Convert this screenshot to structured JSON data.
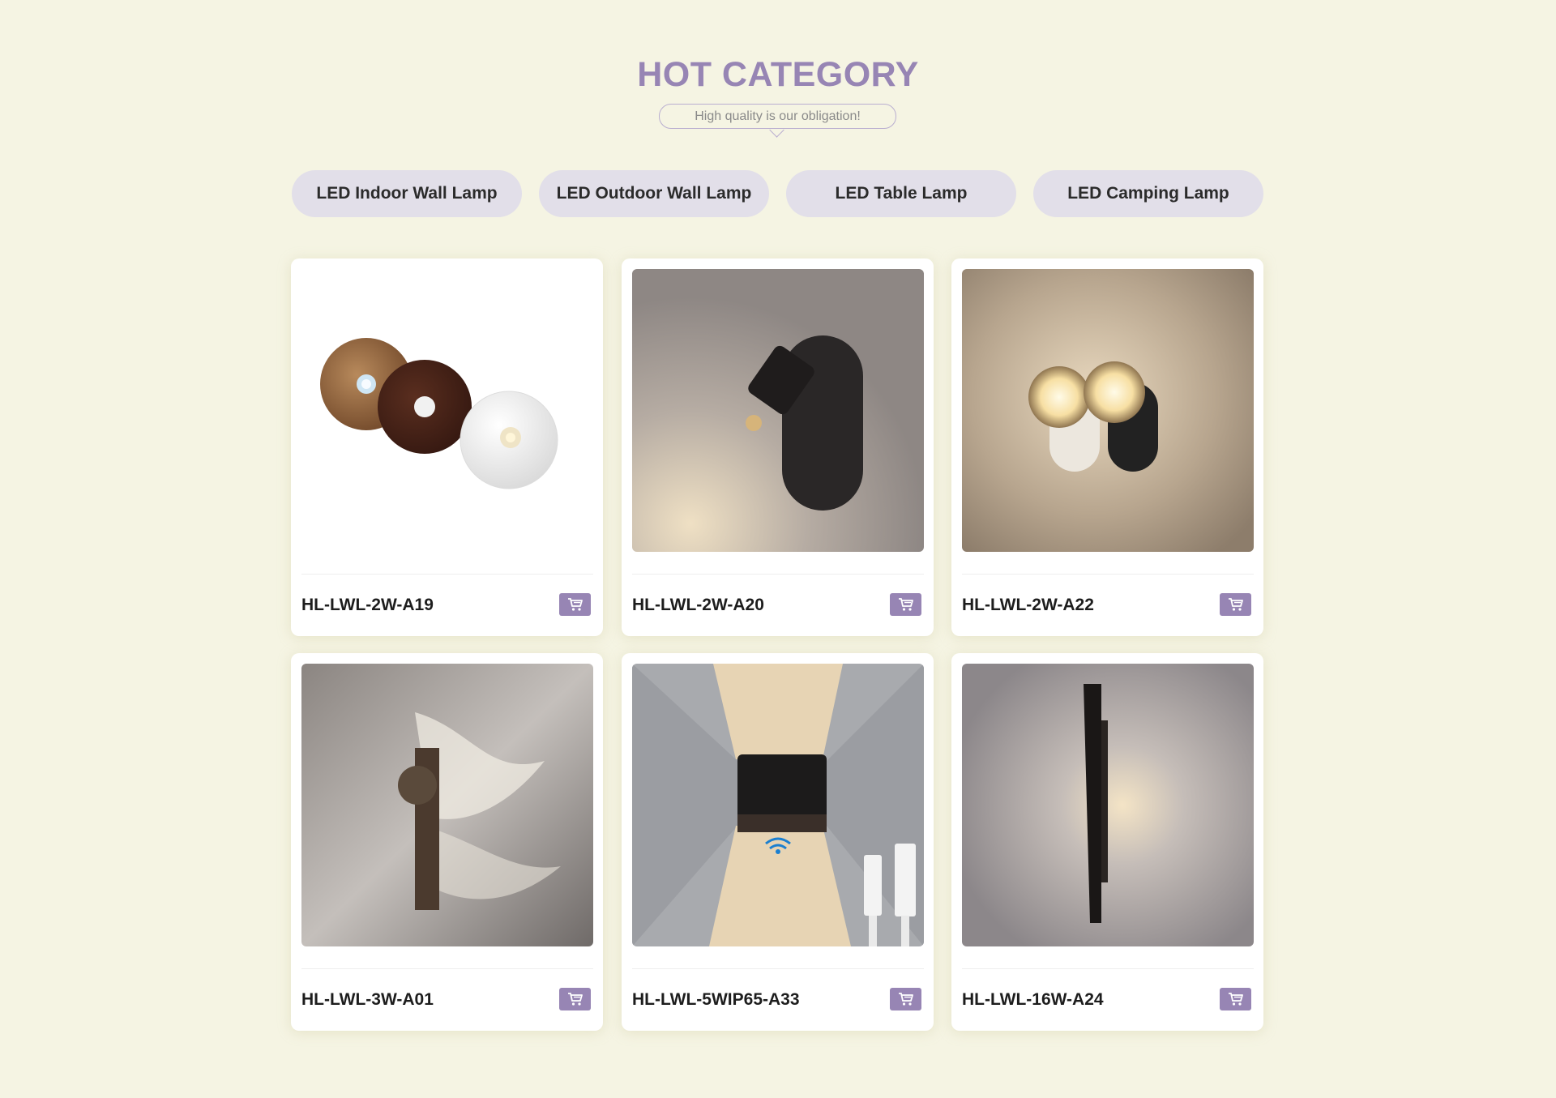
{
  "section": {
    "title": "HOT CATEGORY",
    "subtitle": "High quality is our obligation!"
  },
  "tabs": [
    {
      "label": "LED Indoor Wall Lamp"
    },
    {
      "label": "LED Outdoor Wall Lamp"
    },
    {
      "label": "LED Table Lamp"
    },
    {
      "label": "LED Camping Lamp"
    }
  ],
  "products": [
    {
      "name": "HL-LWL-2W-A19",
      "icon": "cart-icon"
    },
    {
      "name": "HL-LWL-2W-A20",
      "icon": "cart-icon"
    },
    {
      "name": "HL-LWL-2W-A22",
      "icon": "cart-icon"
    },
    {
      "name": "HL-LWL-3W-A01",
      "icon": "cart-icon"
    },
    {
      "name": "HL-LWL-5WIP65-A33",
      "icon": "cart-icon"
    },
    {
      "name": "HL-LWL-16W-A24",
      "icon": "cart-icon"
    }
  ],
  "colors": {
    "background": "#f5f4e3",
    "accent": "#9785b4",
    "tab_bg": "#e2dfe9"
  }
}
